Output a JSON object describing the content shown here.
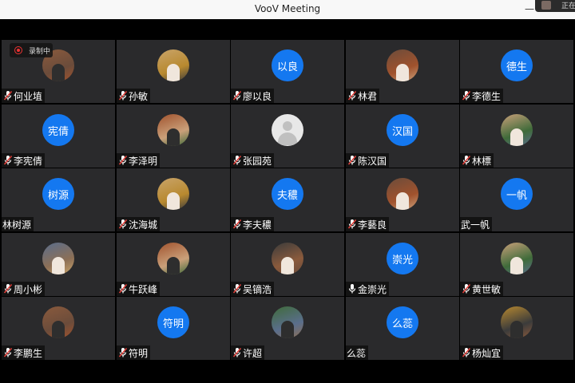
{
  "window": {
    "title": "VooV Meeting",
    "minimize_glyph": "—",
    "self_view_label": "正在"
  },
  "recording": {
    "label": "录制中",
    "icon": "record-icon"
  },
  "colors": {
    "avatar_blue": "#1478f0",
    "tile_bg": "#2a2a2c",
    "mute_red": "#e0403a"
  },
  "participants": [
    {
      "name": "何业埴",
      "avatar_type": "photo",
      "muted": true
    },
    {
      "name": "孙敏",
      "avatar_type": "photo",
      "muted": true
    },
    {
      "name": "廖以良",
      "avatar_type": "text",
      "avatar_text": "以良",
      "muted": true
    },
    {
      "name": "林君",
      "avatar_type": "photo",
      "muted": true
    },
    {
      "name": "李德生",
      "avatar_type": "text",
      "avatar_text": "德生",
      "muted": true
    },
    {
      "name": "李宪倩",
      "avatar_type": "text",
      "avatar_text": "宪倩",
      "muted": true
    },
    {
      "name": "李泽明",
      "avatar_type": "photo",
      "muted": true
    },
    {
      "name": "张园苑",
      "avatar_type": "default",
      "muted": true
    },
    {
      "name": "陈汉国",
      "avatar_type": "text",
      "avatar_text": "汉国",
      "muted": true
    },
    {
      "name": "林標",
      "avatar_type": "photo",
      "muted": true
    },
    {
      "name": "林树源",
      "avatar_type": "text",
      "avatar_text": "树源",
      "muted": false,
      "no_mic": true
    },
    {
      "name": "沈海城",
      "avatar_type": "photo",
      "muted": true
    },
    {
      "name": "李夫穠",
      "avatar_type": "text",
      "avatar_text": "夫穠",
      "muted": true
    },
    {
      "name": "李藝良",
      "avatar_type": "photo",
      "muted": true
    },
    {
      "name": "武一帆",
      "avatar_type": "text",
      "avatar_text": "一帆",
      "muted": false,
      "no_mic": true
    },
    {
      "name": "周小彬",
      "avatar_type": "photo",
      "muted": true
    },
    {
      "name": "牛跃峰",
      "avatar_type": "photo",
      "muted": true
    },
    {
      "name": "吴镝浩",
      "avatar_type": "photo",
      "muted": true
    },
    {
      "name": "金崇光",
      "avatar_type": "text",
      "avatar_text": "崇光",
      "muted": false
    },
    {
      "name": "黄世敏",
      "avatar_type": "photo",
      "muted": true
    },
    {
      "name": "李鹏生",
      "avatar_type": "photo",
      "muted": true
    },
    {
      "name": "符明",
      "avatar_type": "text",
      "avatar_text": "符明",
      "muted": true
    },
    {
      "name": "许超",
      "avatar_type": "photo",
      "muted": true
    },
    {
      "name": "么蕊",
      "avatar_type": "text",
      "avatar_text": "么蕊",
      "muted": false,
      "no_mic": true
    },
    {
      "name": "杨灿宜",
      "avatar_type": "photo",
      "muted": true
    }
  ],
  "photo_palette": [
    "#8a5a3c",
    "#c9a46a",
    "#3f6b3a",
    "#6b4c3b",
    "#b8892f",
    "#5a6e8c",
    "#a0522d",
    "#3b3b3b",
    "#8c6f56",
    "#caa07a"
  ]
}
